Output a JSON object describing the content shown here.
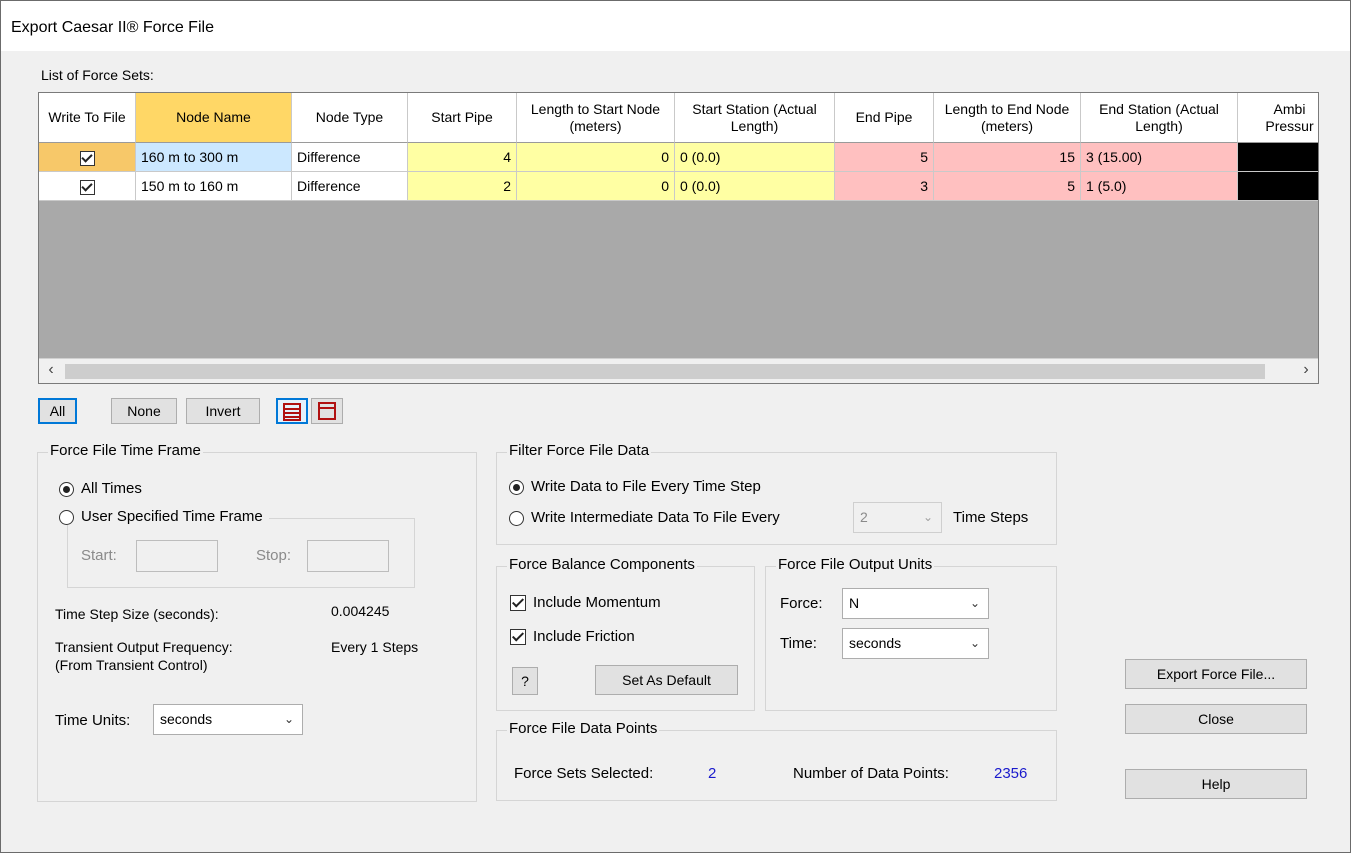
{
  "window": {
    "title": "Export Caesar II® Force File"
  },
  "grid": {
    "label": "List of Force Sets:",
    "columns": [
      "Write To File",
      "Node Name",
      "Node Type",
      "Start Pipe",
      "Length to Start Node (meters)",
      "Start Station (Actual Length)",
      "End Pipe",
      "Length to End Node (meters)",
      "End Station (Actual Length)",
      "Ambi Pressur"
    ],
    "rows": [
      {
        "write": true,
        "node_name": "160 m to 300 m",
        "node_type": "Difference",
        "start_pipe": "4",
        "len_start": "0",
        "start_station": "0 (0.0)",
        "end_pipe": "5",
        "len_end": "15",
        "end_station": "3 (15.00)"
      },
      {
        "write": true,
        "node_name": "150 m to 160 m",
        "node_type": "Difference",
        "start_pipe": "2",
        "len_start": "0",
        "start_station": "0 (0.0)",
        "end_pipe": "3",
        "len_end": "5",
        "end_station": "1 (5.0)"
      }
    ]
  },
  "selection_buttons": {
    "all": "All",
    "none": "None",
    "invert": "Invert"
  },
  "time_frame": {
    "title": "Force File Time Frame",
    "all_times": "All Times",
    "user_specified": "User Specified Time Frame",
    "start_label": "Start:",
    "stop_label": "Stop:",
    "step_size_label": "Time Step Size (seconds):",
    "step_size_value": "0.004245",
    "output_freq_label": "Transient Output Frequency:",
    "output_freq_sub": "(From Transient Control)",
    "output_freq_value": "Every 1 Steps",
    "time_units_label": "Time Units:",
    "time_units_value": "seconds"
  },
  "filter": {
    "title": "Filter Force File Data",
    "every_step": "Write Data to File Every Time Step",
    "intermediate": "Write Intermediate Data To File Every",
    "intermediate_value": "2",
    "time_steps": "Time Steps"
  },
  "balance": {
    "title": "Force Balance Components",
    "momentum": "Include Momentum",
    "friction": "Include Friction",
    "help": "?",
    "set_default": "Set As Default"
  },
  "units": {
    "title": "Force File Output Units",
    "force_label": "Force:",
    "force_value": "N",
    "time_label": "Time:",
    "time_value": "seconds"
  },
  "data_points": {
    "title": "Force File Data Points",
    "sets_label": "Force Sets Selected:",
    "sets_value": "2",
    "points_label": "Number of Data Points:",
    "points_value": "2356"
  },
  "actions": {
    "export": "Export Force File...",
    "close": "Close",
    "help": "Help"
  }
}
